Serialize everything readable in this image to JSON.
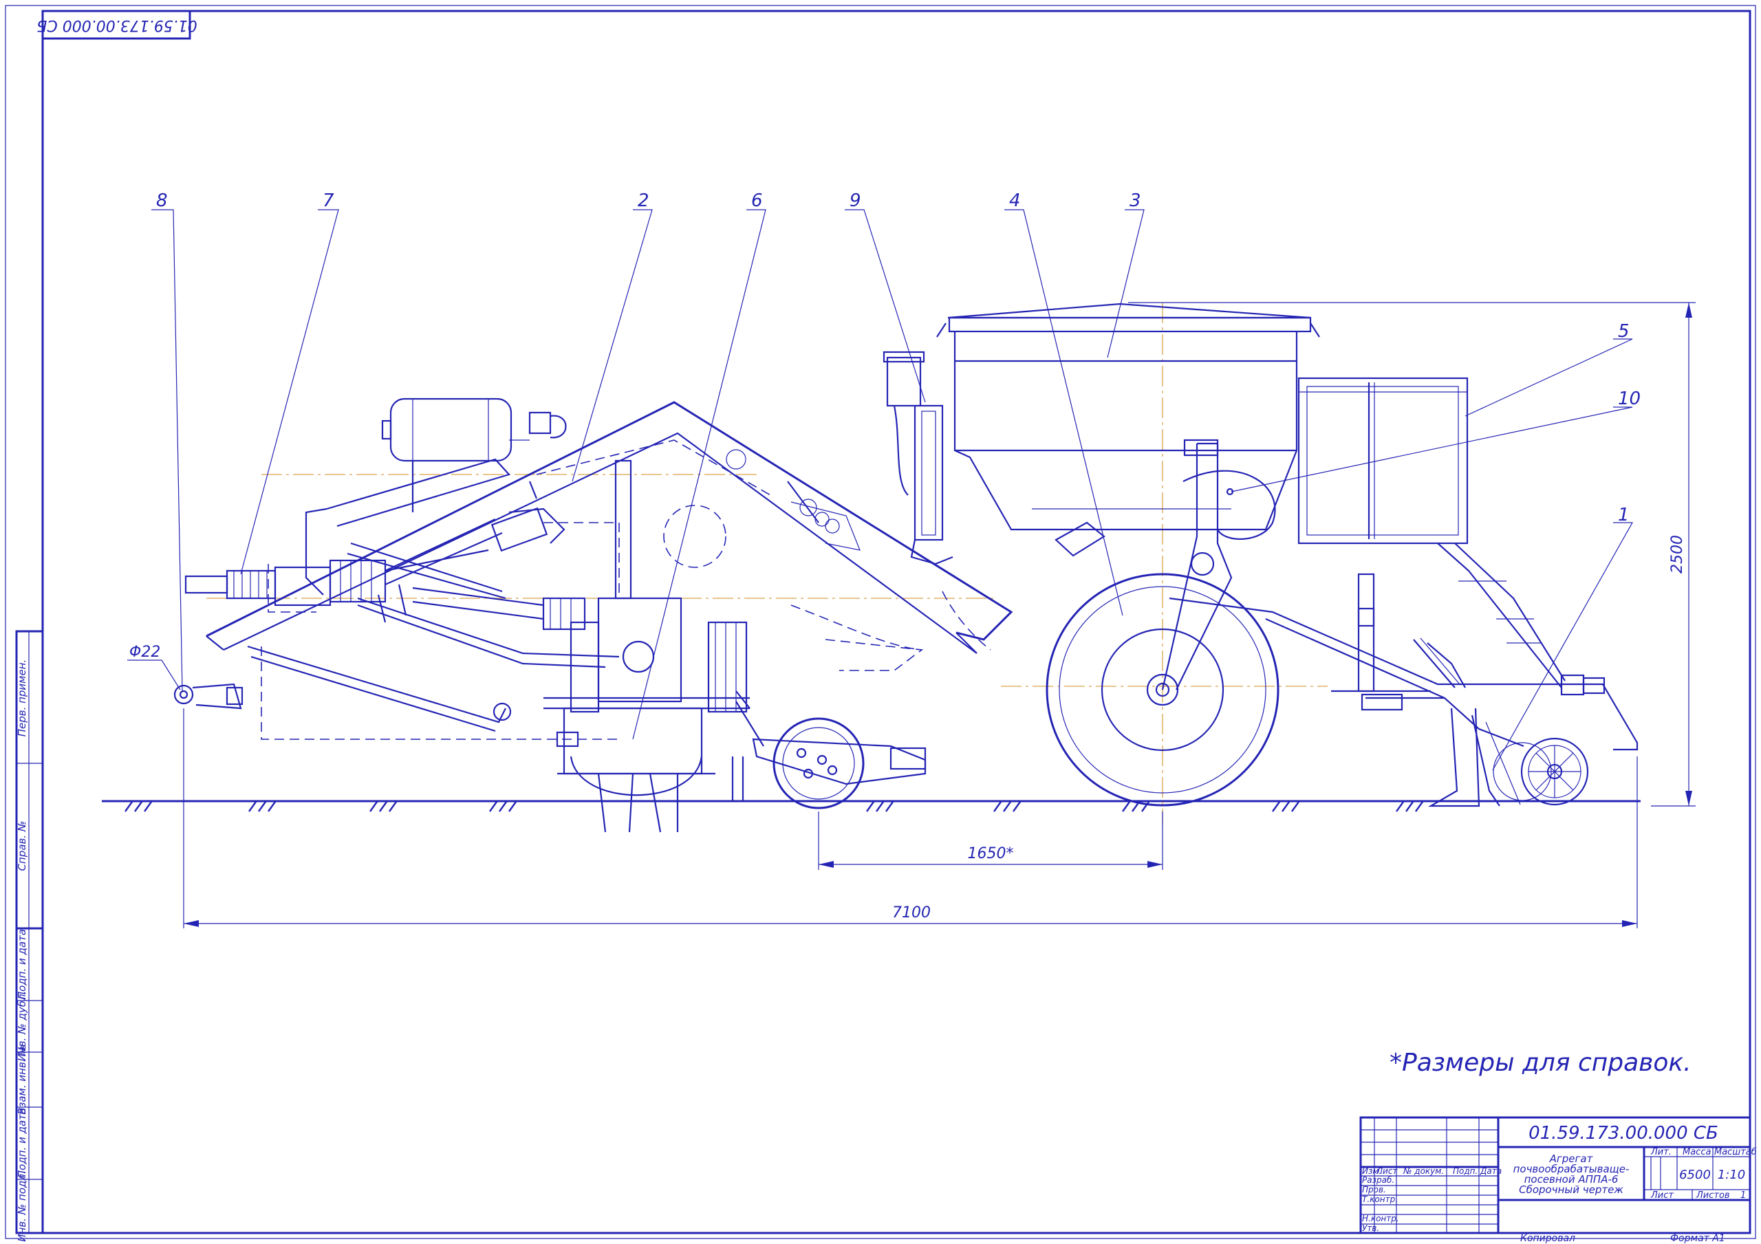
{
  "document": {
    "code_top_mirrored": "01.59.173.00.000 СБ",
    "note": "*Размеры для справок."
  },
  "callouts": [
    "8",
    "7",
    "2",
    "6",
    "9",
    "4",
    "3",
    "5",
    "10",
    "1"
  ],
  "dimensions": {
    "hitch_diameter": "Φ22",
    "wheel_spacing": "1650*",
    "overall_length": "7100",
    "overall_height": "2500"
  },
  "side_stamp": [
    "Перв. примен.",
    "Справ. №",
    "Подп. и дата",
    "Инв. № дубл.",
    "Взам. инв. №",
    "Подп. и дата",
    "Инв. № подл."
  ],
  "title_block": {
    "designation": "01.59.173.00.000 СБ",
    "name_lines": [
      "Агрегат",
      "почвообрабатываще-",
      "посевной АППА-6",
      "Сборочный чертеж"
    ],
    "col_headers": [
      "Изм.",
      "Лист",
      "№ докум.",
      "Подп.",
      "Дата"
    ],
    "row_labels": [
      "Разраб.",
      "Пров.",
      "Т.контр.",
      "Н.контр.",
      "Утв."
    ],
    "lit_label": "Лит.",
    "mass_label": "Масса",
    "scale_label": "Масштаб",
    "mass_value": "6500",
    "scale_value": "1:10",
    "sheet_label": "Лист",
    "sheets_label": "Листов",
    "sheets_value": "1",
    "copied": "Копировал",
    "format": "Формат A1"
  }
}
